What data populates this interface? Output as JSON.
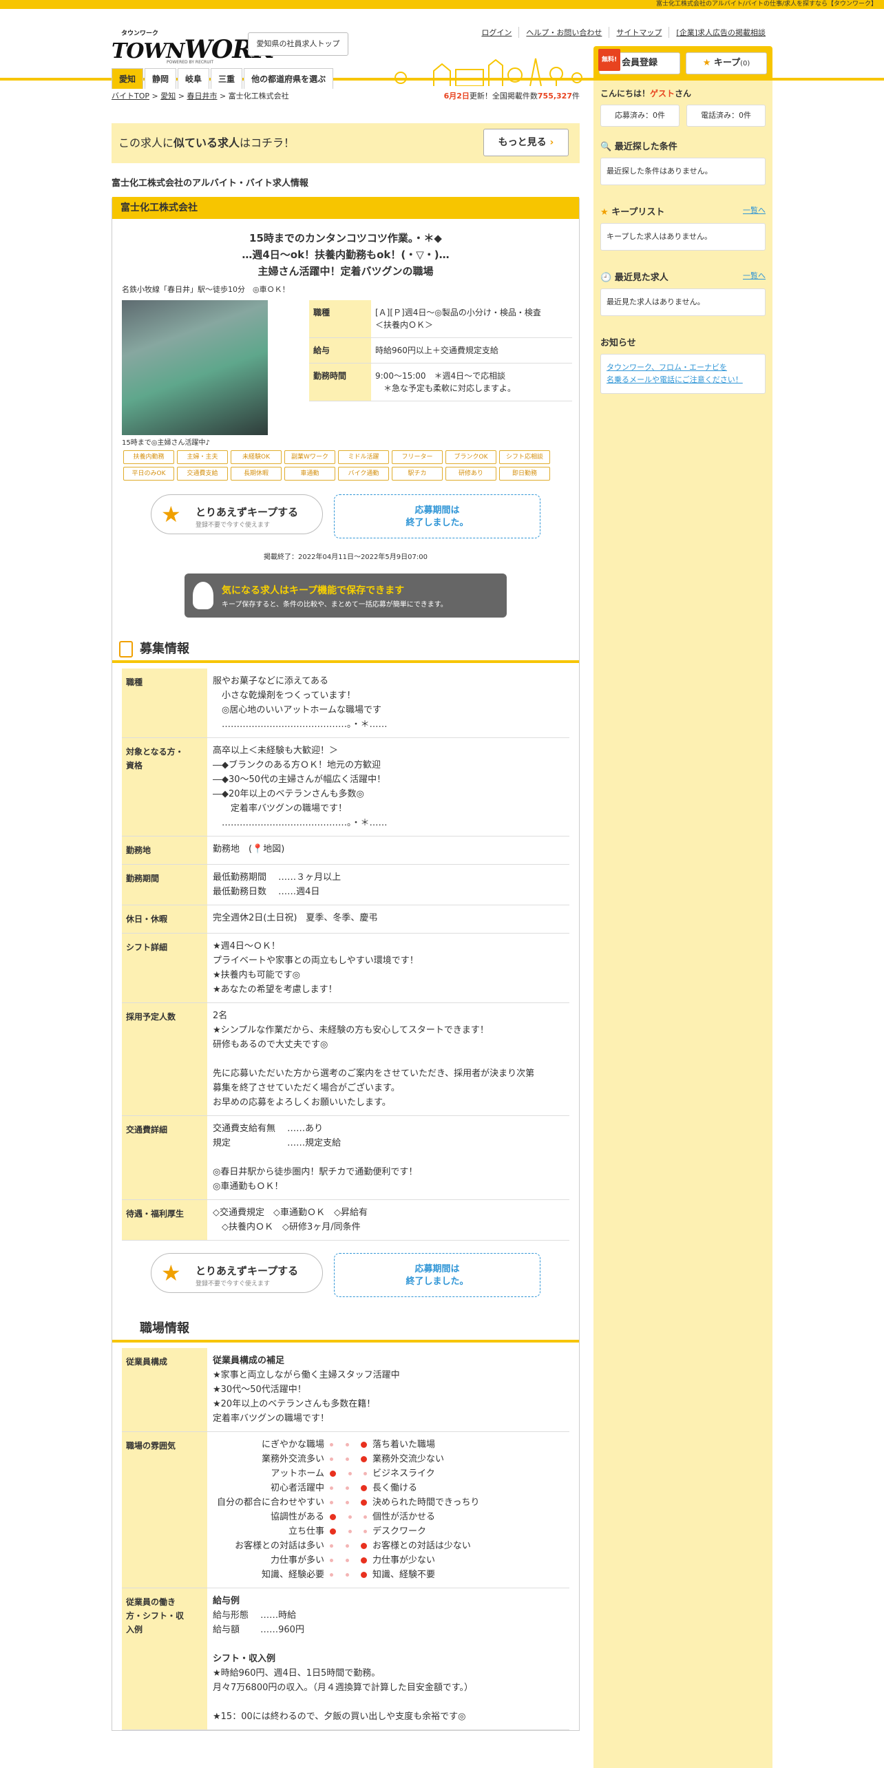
{
  "topbar": "富士化工株式会社のアルバイト/バイトの仕事/求人を探すなら【タウンワーク】",
  "logo": {
    "kana": "タウンワーク",
    "word1": "TOWN",
    "word2": "WORK",
    "powered": "POWERED BY RECRUIT"
  },
  "header": {
    "pref_button": "愛知県の社員求人トップ",
    "links": [
      "ログイン",
      "ヘルプ・お問い合わせ",
      "サイトマップ",
      "[企業]求人広告の掲載相談"
    ],
    "free": "無料!",
    "register": "会員登録",
    "keep": "キープ",
    "keep_count": "(0)"
  },
  "tabs": [
    "愛知",
    "静岡",
    "岐阜",
    "三重",
    "他の都道府県を選ぶ"
  ],
  "breadcrumb": [
    "バイトTOP",
    "愛知",
    "春日井市",
    "富士化工株式会社"
  ],
  "count": {
    "date": "6月2日",
    "mid": "更新！全国掲載件数",
    "num": "755,327",
    "unit": "件"
  },
  "suit": {
    "pre": "この求人に",
    "bold": "似ている求人",
    "post": "はコチラ！",
    "more": "もっと見る"
  },
  "page_title": "富士化工株式会社のアルバイト・バイト求人情報",
  "company": "富士化工株式会社",
  "catch": [
    "15時までのカンタンコツコツ作業。・＊◆",
    "…週4日～ok！扶養内勤務もok！(・▽・)…",
    "主婦さん活躍中！定着バツグンの職場"
  ],
  "access": "名鉄小牧線「春日井」駅～徒歩10分　◎車ＯＫ！",
  "photo_caption": "15時まで◎主婦さん活躍中♪",
  "summary": [
    {
      "k": "職種",
      "v": "[Ａ][Ｐ]週4日～◎製品の小分け・検品・検査\n＜扶養内ＯＫ＞"
    },
    {
      "k": "給与",
      "v": "時給960円以上＋交通費規定支給"
    },
    {
      "k": "勤務時間",
      "v": "9:00～15:00　＊週4日～で応相談\n　＊急な予定も柔軟に対応しますよ。"
    }
  ],
  "tags": [
    "扶養内勤務",
    "主婦・主夫",
    "未経験OK",
    "副業Wワーク",
    "ミドル活躍",
    "フリーター",
    "ブランクOK",
    "シフト応相談",
    "平日のみOK",
    "交通費支給",
    "長期休暇",
    "車通勤",
    "バイク通勤",
    "駅チカ",
    "研修あり",
    "即日勤務"
  ],
  "keep_btn": {
    "t1": "とりあえずキープする",
    "t2": "登録不要で今すぐ使えます"
  },
  "end_btn": "応募期間は\n終了しました。",
  "period": "掲載終了：2022年04月11日～2022年5月9日07:00",
  "banner": {
    "t1": "気になる求人はキープ機能で保存できます",
    "t2": "キープ保存すると、条件の比較や、まとめて一括応募が簡単にできます。"
  },
  "sec1": "募集情報",
  "details": [
    {
      "k": "職種",
      "v": "服やお菓子などに添えてある\n　小さな乾燥剤をつくっています！\n　◎居心地のいいアットホームな職場です\n　……………………………………。・＊……"
    },
    {
      "k": "対象となる方・\n資格",
      "v": "高卒以上＜未経験も大歓迎！＞\n―◆ブランクのある方ＯＫ！地元の方歓迎\n―◆30～50代の主婦さんが幅広く活躍中！\n―◆20年以上のベテランさんも多数◎\n　　定着率バツグンの職場です！\n　……………………………………。・＊……"
    },
    {
      "k": "勤務地",
      "v": "勤務地　(📍地図)"
    },
    {
      "k": "勤務期間",
      "v": "最低勤務期間　 ……３ヶ月以上\n最低勤務日数　 ……週4日"
    },
    {
      "k": "休日・休暇",
      "v": "完全週休2日(土日祝)　夏季、冬季、慶弔"
    },
    {
      "k": "シフト詳細",
      "v": "★週4日～ＯＫ！\nプライベートや家事との両立もしやすい環境です！\n★扶養内も可能です◎\n★あなたの希望を考慮します！"
    },
    {
      "k": "採用予定人数",
      "v": "2名\n★シンプルな作業だから、未経験の方も安心してスタートできます！\n研修もあるので大丈夫です◎\n\n先に応募いただいた方から選考のご案内をさせていただき、採用者が決まり次第\n募集を終了させていただく場合がございます。\nお早めの応募をよろしくお願いいたします。"
    },
    {
      "k": "交通費詳細",
      "v": "交通費支給有無　 ……あり\n規定　　　　　　 ……規定支給\n\n◎春日井駅から徒歩圏内！駅チカで通勤便利です！\n◎車通勤もＯＫ！"
    },
    {
      "k": "待遇・福利厚生",
      "v": "◇交通費規定　◇車通勤ＯＫ　◇昇給有\n　◇扶養内ＯＫ　◇研修3ヶ月/同条件"
    }
  ],
  "sec2": "職場情報",
  "staff": {
    "k": "従業員構成",
    "title": "従業員構成の補足",
    "v": "★家事と両立しながら働く主婦スタッフ活躍中\n★30代～50代活躍中！\n★20年以上のベテランさんも多数在籍！\n定着率バツグンの職場です！"
  },
  "mood_k": "職場の雰囲気",
  "mood": [
    {
      "l": "にぎやかな職場",
      "r": "落ち着いた職場",
      "pos": 3
    },
    {
      "l": "業務外交流多い",
      "r": "業務外交流少ない",
      "pos": 3
    },
    {
      "l": "アットホーム",
      "r": "ビジネスライク",
      "pos": 1
    },
    {
      "l": "初心者活躍中",
      "r": "長く働ける",
      "pos": 3
    },
    {
      "l": "自分の都合に合わせやすい",
      "r": "決められた時間できっちり",
      "pos": 3
    },
    {
      "l": "協調性がある",
      "r": "個性が活かせる",
      "pos": 1
    },
    {
      "l": "立ち仕事",
      "r": "デスクワーク",
      "pos": 1
    },
    {
      "l": "お客様との対話は多い",
      "r": "お客様との対話は少ない",
      "pos": 3
    },
    {
      "l": "力仕事が多い",
      "r": "力仕事が少ない",
      "pos": 3
    },
    {
      "l": "知識、経験必要",
      "r": "知識、経験不要",
      "pos": 3
    }
  ],
  "work": {
    "k": "従業員の働き\n方・シフト・収\n入例",
    "t1": "給与例",
    "v1": "給与形態　 ……時給\n給与額　　 ……960円",
    "t2": "シフト・収入例",
    "v2": "★時給960円、週4日、1日5時間で勤務。\n月々7万6800円の収入。（月４週換算で計算した目安金額です。）\n\n★15：00には終わるので、夕飯の買い出しや支度も余裕です◎"
  },
  "side": {
    "hello": "こんにちは！",
    "guest": "ゲスト",
    "san": "さん",
    "applied": "応募済み：0件",
    "called": "電話済み：0件",
    "recent_search": "最近探した条件",
    "recent_search_empty": "最近探した条件はありません。",
    "keeplist": "キープリスト",
    "keep_empty": "キープした求人はありません。",
    "list_link": "一覧へ",
    "recent_view": "最近見た求人",
    "recent_view_empty": "最近見た求人はありません。",
    "notice": "お知らせ",
    "notice_text": "タウンワーク、フロム・エーナビを\n名乗るメールや電話にご注意ください！"
  }
}
